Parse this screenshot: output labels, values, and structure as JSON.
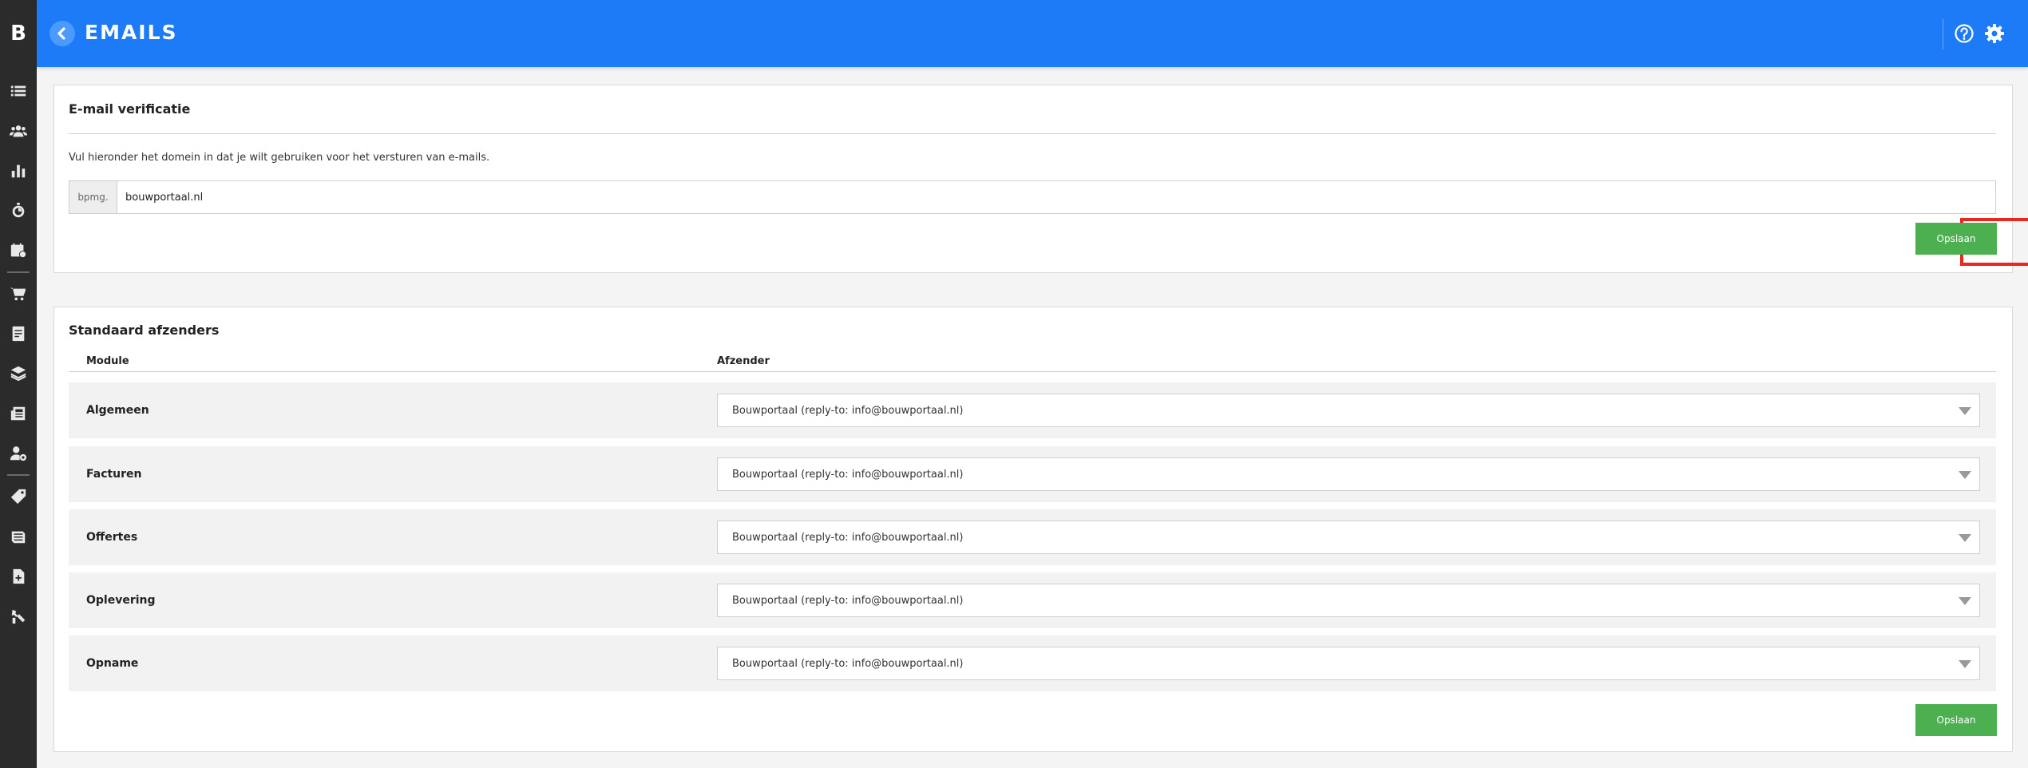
{
  "sidebar": {
    "logo": "B",
    "icons": [
      "list-icon",
      "users-icon",
      "bar-chart-icon",
      "stopwatch-icon",
      "calendar-clock-icon",
      "cart-icon",
      "document-icon",
      "layers-icon",
      "newspaper-icon",
      "user-gear-icon",
      "tag-icon",
      "book-icon",
      "file-plus-icon",
      "hand-tools-icon"
    ]
  },
  "header": {
    "title": "EMAILS",
    "background": "#1d7bf7"
  },
  "verification": {
    "title": "E-mail verificatie",
    "description": "Vul hieronder het domein in dat je wilt gebruiken voor het versturen van e-mails.",
    "addon": "bpmg.",
    "domain_value": "bouwportaal.nl",
    "save_label": "Opslaan"
  },
  "senders": {
    "title": "Standaard afzenders",
    "col_module": "Module",
    "col_sender": "Afzender",
    "rows": [
      {
        "module": "Algemeen",
        "sender": "Bouwportaal (reply-to: info@bouwportaal.nl)"
      },
      {
        "module": "Facturen",
        "sender": "Bouwportaal (reply-to: info@bouwportaal.nl)"
      },
      {
        "module": "Offertes",
        "sender": "Bouwportaal (reply-to: info@bouwportaal.nl)"
      },
      {
        "module": "Oplevering",
        "sender": "Bouwportaal (reply-to: info@bouwportaal.nl)"
      },
      {
        "module": "Opname",
        "sender": "Bouwportaal (reply-to: info@bouwportaal.nl)"
      }
    ],
    "save_label": "Opslaan"
  },
  "colors": {
    "accent": "#1d7bf7",
    "success": "#4caf50",
    "highlight": "#e8281e",
    "sidebar": "#2b2b2b"
  }
}
